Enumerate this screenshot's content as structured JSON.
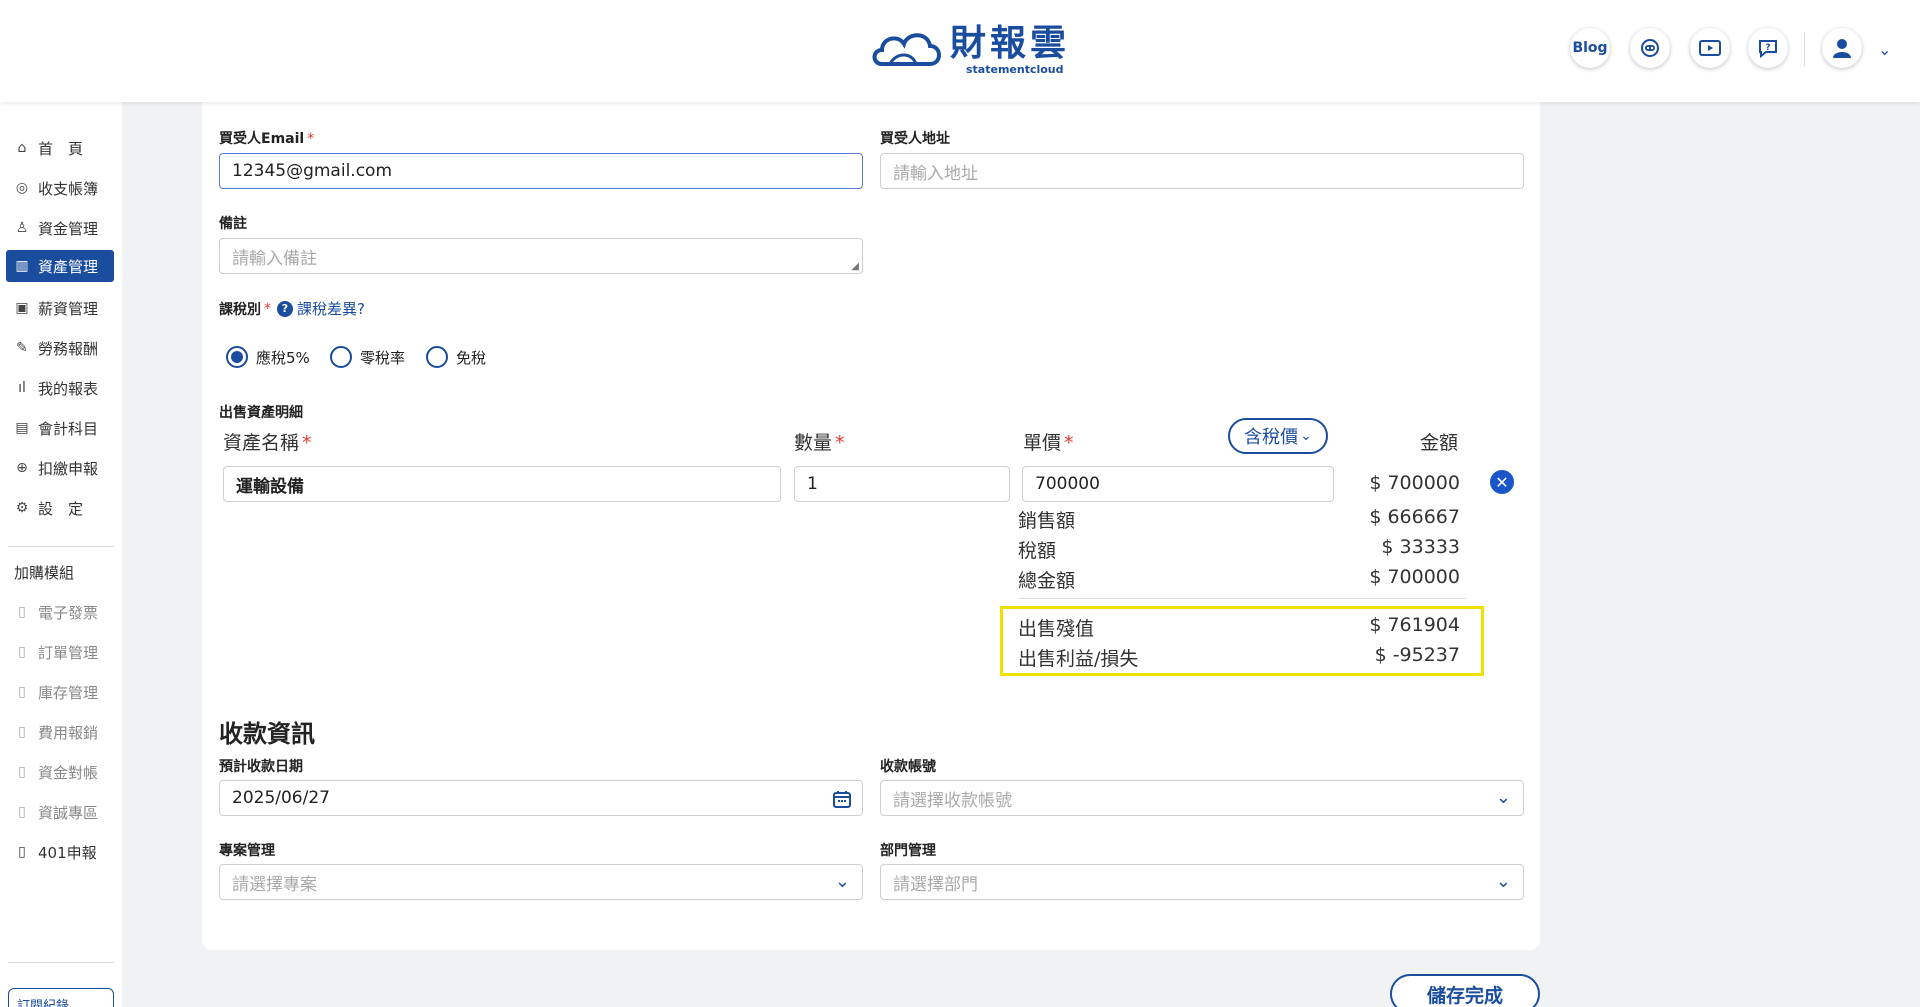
{
  "brand": {
    "name": "財報雲",
    "sub": "statementcloud"
  },
  "header": {
    "blog_label": "Blog"
  },
  "sidebar": {
    "items": [
      {
        "label": "首　頁",
        "icon": "home-icon"
      },
      {
        "label": "收支帳簿",
        "icon": "coin-icon"
      },
      {
        "label": "資金管理",
        "icon": "fund-icon"
      },
      {
        "label": "資產管理",
        "icon": "asset-icon"
      },
      {
        "label": "薪資管理",
        "icon": "salary-icon"
      },
      {
        "label": "勞務報酬",
        "icon": "labor-icon"
      },
      {
        "label": "我的報表",
        "icon": "report-icon"
      },
      {
        "label": "會計科目",
        "icon": "ledger-icon"
      },
      {
        "label": "扣繳申報",
        "icon": "tax-icon"
      },
      {
        "label": "設　定",
        "icon": "settings-icon"
      }
    ],
    "addon_title": "加購模組",
    "addons": [
      "電子發票",
      "訂單管理",
      "庫存管理",
      "費用報銷",
      "資金對帳",
      "資誠專區",
      "401申報"
    ],
    "subscription_label": "訂閱紀錄"
  },
  "form": {
    "buyer_email_label": "買受人Email",
    "buyer_email_value": "12345@gmail.com",
    "buyer_address_label": "買受人地址",
    "buyer_address_placeholder": "請輸入地址",
    "note_label": "備註",
    "note_placeholder": "請輸入備註",
    "tax_type_label": "課稅別",
    "tax_diff_link": "課稅差異?",
    "tax_options": [
      "應稅5%",
      "零稅率",
      "免稅"
    ],
    "tax_selected": "應稅5%"
  },
  "details": {
    "title": "出售資產明細",
    "col_name": "資產名稱",
    "col_qty": "數量",
    "col_price": "單價",
    "tax_mode": "含稅價",
    "col_amount": "金額",
    "row": {
      "name": "運輸設備",
      "qty": "1",
      "price": "700000",
      "amount": "$ 700000"
    },
    "sales_label": "銷售額",
    "sales_value": "$ 666667",
    "tax_label": "稅額",
    "tax_value": "$ 33333",
    "total_label": "總金額",
    "total_value": "$ 700000",
    "residual_label": "出售殘值",
    "residual_value": "$ 761904",
    "gainloss_label": "出售利益/損失",
    "gainloss_value": "$ -95237"
  },
  "payment": {
    "title": "收款資訊",
    "date_label": "預計收款日期",
    "date_value": "2025/06/27",
    "account_label": "收款帳號",
    "account_placeholder": "請選擇收款帳號",
    "project_label": "專案管理",
    "project_placeholder": "請選擇專案",
    "dept_label": "部門管理",
    "dept_placeholder": "請選擇部門"
  },
  "actions": {
    "save_label": "儲存完成"
  }
}
